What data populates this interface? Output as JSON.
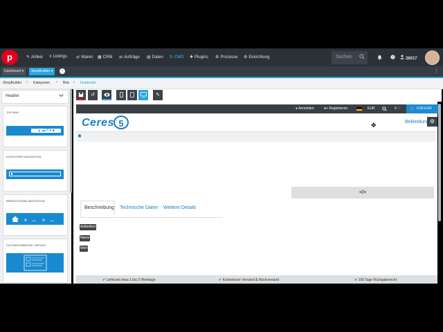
{
  "nav": {
    "logo": "p",
    "items": [
      {
        "icon": "✎",
        "label": "Artikel"
      },
      {
        "icon": "≡",
        "label": "Listings"
      },
      {
        "icon": "⇄",
        "label": "Waren"
      },
      {
        "icon": "▦",
        "label": "CRM"
      },
      {
        "icon": "⇄",
        "label": "Aufträge"
      },
      {
        "icon": "▤",
        "label": "Daten"
      },
      {
        "icon": "↻",
        "label": "CMS"
      },
      {
        "icon": "✚",
        "label": "Plugins"
      },
      {
        "icon": "⚙",
        "label": "Prozesse"
      },
      {
        "icon": "⚙",
        "label": "Einrichtung"
      }
    ],
    "search_placeholder": "Suchen",
    "user_id": "28017"
  },
  "tabs": {
    "dashboard": "Dashboard ▾",
    "shopbuilder": "ShopBuilder ▾"
  },
  "breadcrumb": [
    "ShopBuilder",
    "Kategorien",
    "Bob",
    "headerdet"
  ],
  "sidebar": {
    "header_select": "Header",
    "cards": [
      {
        "title": "TOP BAR"
      },
      {
        "title": "KATEGORIE-NAVIGATION"
      },
      {
        "title": "BREADCRUMB-NAVIGATION"
      },
      {
        "title": "SUCHERGEBNISSE: ARTIKEL"
      }
    ]
  },
  "preview": {
    "topbar": {
      "login": "Anmelden",
      "register": "Registrieren",
      "currency": "EUR",
      "count": "0",
      "cart": "0,00 EUR"
    },
    "logo_text": "Ceres",
    "logo_number": "5",
    "category_link": "Bekleidung",
    "code_icon": "</>",
    "tabs": [
      "Beschreibung",
      "Technische Daten",
      "Weitere Details"
    ],
    "labels": [
      "Artikeltext",
      "Name",
      "Wert"
    ],
    "footer": [
      "✔ Lieferzeit etwa 1 bis 3 Werktage",
      "✔ Kostenloser Versand & Rückversand",
      "✔ 100 Tage Rückgaberecht"
    ]
  },
  "colors": {
    "accent": "#29a6de",
    "nav_bg": "#2b3137",
    "brand_red": "#e3001b"
  }
}
